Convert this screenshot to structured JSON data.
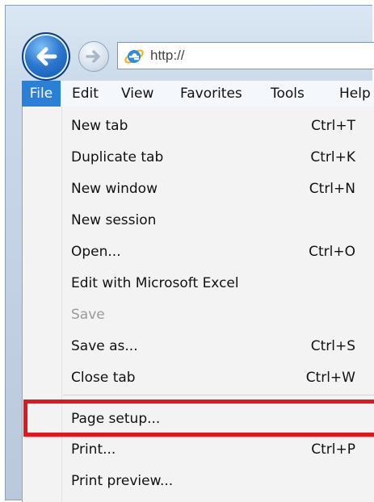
{
  "address_bar": {
    "url": "http://"
  },
  "menu_bar": {
    "items": [
      "File",
      "Edit",
      "View",
      "Favorites",
      "Tools",
      "Help"
    ],
    "active": "File"
  },
  "file_menu": {
    "items": [
      {
        "label": "New tab",
        "shortcut": "Ctrl+T",
        "enabled": true
      },
      {
        "label": "Duplicate tab",
        "shortcut": "Ctrl+K",
        "enabled": true
      },
      {
        "label": "New window",
        "shortcut": "Ctrl+N",
        "enabled": true
      },
      {
        "label": "New session",
        "shortcut": "",
        "enabled": true
      },
      {
        "label": "Open...",
        "shortcut": "Ctrl+O",
        "enabled": true
      },
      {
        "label": "Edit with Microsoft Excel",
        "shortcut": "",
        "enabled": true
      },
      {
        "label": "Save",
        "shortcut": "",
        "enabled": false
      },
      {
        "label": "Save as...",
        "shortcut": "Ctrl+S",
        "enabled": true
      },
      {
        "label": "Close tab",
        "shortcut": "Ctrl+W",
        "enabled": true
      },
      {
        "label": "Page setup...",
        "shortcut": "",
        "enabled": true,
        "highlighted": true
      },
      {
        "label": "Print...",
        "shortcut": "Ctrl+P",
        "enabled": true
      },
      {
        "label": "Print preview...",
        "shortcut": "",
        "enabled": true
      }
    ]
  },
  "colors": {
    "active_menu": "#2a7fd6",
    "highlight_outline": "#e8141b",
    "disabled_text": "#9a9a9a",
    "menu_background": "#f3f3f3"
  },
  "icons": {
    "back": "back-arrow-icon",
    "forward": "forward-arrow-icon",
    "browser": "internet-explorer-icon"
  }
}
